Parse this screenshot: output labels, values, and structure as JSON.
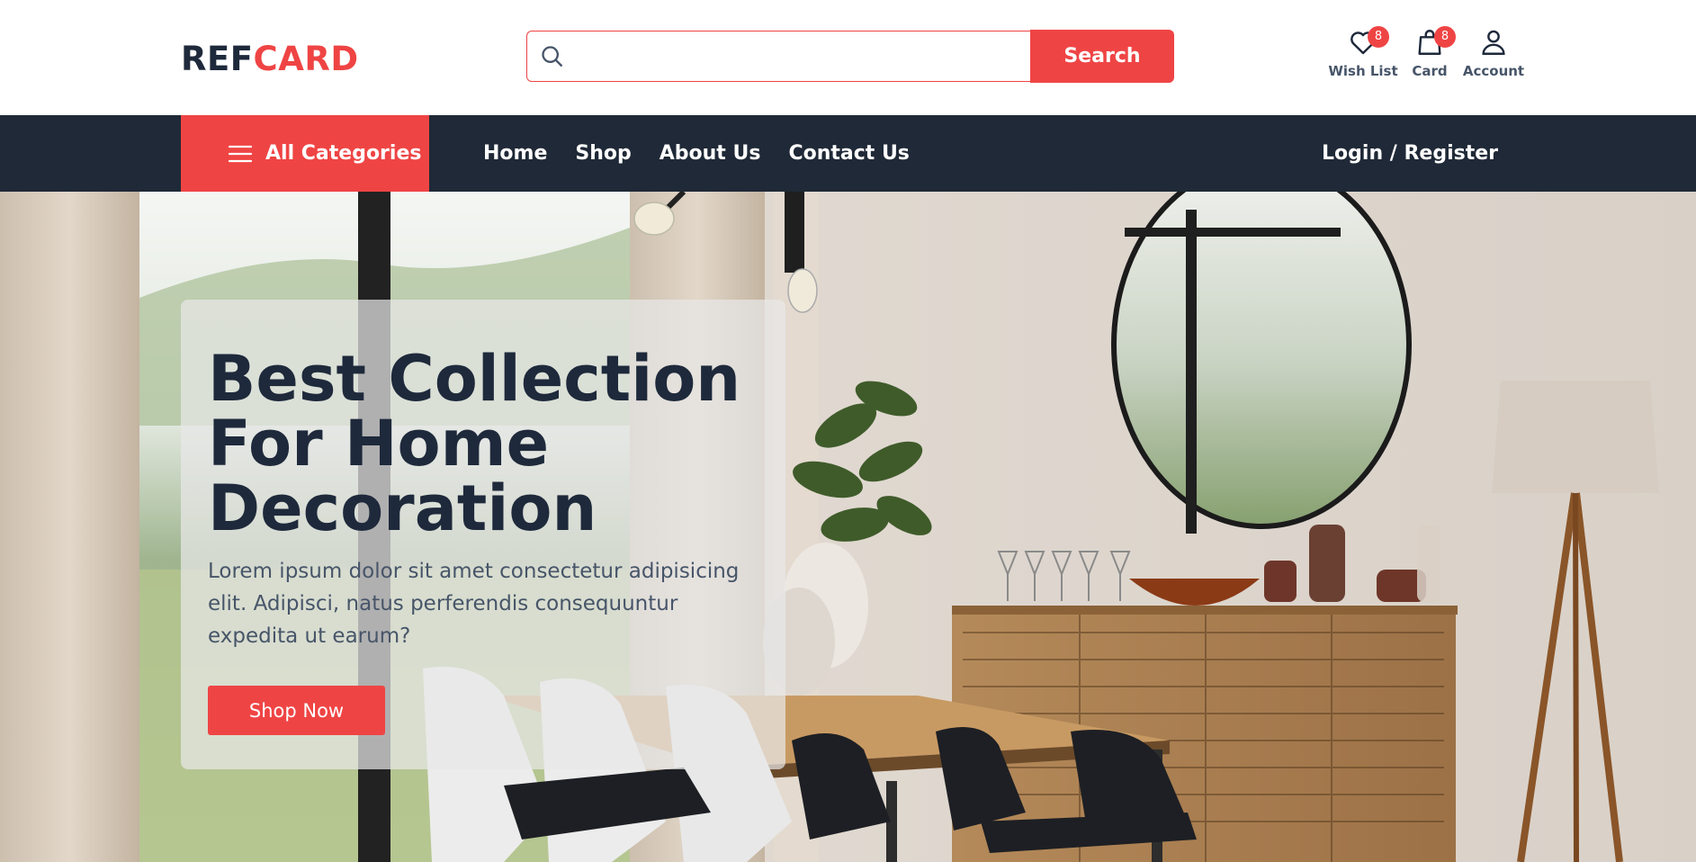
{
  "header": {
    "logo_part1": "REF",
    "logo_part2": "CARD",
    "search": {
      "placeholder": "",
      "value": "",
      "button_label": "Search"
    },
    "icons": {
      "wishlist": {
        "label": "Wish List",
        "count": "8",
        "icon": "heart-icon"
      },
      "cart": {
        "label": "Card",
        "count": "8",
        "icon": "shopping-bag-icon"
      },
      "account": {
        "label": "Account",
        "icon": "user-icon"
      }
    }
  },
  "nav": {
    "categories_label": "All Categories",
    "links": [
      "Home",
      "Shop",
      "About Us",
      "Contact Us"
    ],
    "login_label": "Login / Register"
  },
  "hero": {
    "title_line1": "Best Collection",
    "title_line2": "For Home",
    "title_line3": "Decoration",
    "text": "Lorem ipsum dolor sit amet consectetur adipisicing elit. Adipisci, natus perferendis consequuntur expedita ut earum?",
    "button_label": "Shop Now"
  },
  "colors": {
    "accent": "#ef4444",
    "dark": "#1f2937",
    "heading": "#1e293b",
    "muted": "#475569"
  }
}
